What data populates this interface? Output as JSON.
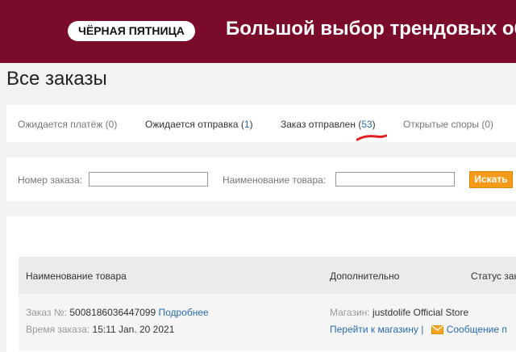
{
  "banner": {
    "badge": "ЧЁРНАЯ ПЯТНИЦА",
    "headline": "Большой выбор трендовых обр",
    "bg_color": "#7a0b2a"
  },
  "page_title": "Все заказы",
  "tabs": [
    {
      "label": "Ожидается платёж",
      "count": "0",
      "active": false
    },
    {
      "label": "Ожидается отправка",
      "count": "1",
      "active": false
    },
    {
      "label": "Заказ отправлен",
      "count": "53",
      "active": true
    },
    {
      "label": "Открытые споры",
      "count": "0",
      "active": false
    }
  ],
  "search": {
    "order_number_label": "Номер заказа:",
    "order_number_value": "",
    "product_name_label": "Наименование товара:",
    "product_name_value": "",
    "button_label": "Искать",
    "button_color": "#f69a1a"
  },
  "table": {
    "headers": {
      "product": "Наименование товара",
      "additional": "Дополнительно",
      "status": "Статус зак"
    },
    "rows": [
      {
        "order_no_label": "Заказ №:",
        "order_no": "5008186036447099",
        "details_link": "Подробнее",
        "time_label": "Время заказа:",
        "time": "15:11 Jan. 20 2021",
        "store_label": "Магазин:",
        "store": "justdolife Official Store",
        "go_to_store": "Перейти к магазину",
        "separator": "|",
        "message": "Сообщение п"
      }
    ]
  },
  "colors": {
    "link": "#2a6cb0",
    "annotation": "#e02020"
  }
}
